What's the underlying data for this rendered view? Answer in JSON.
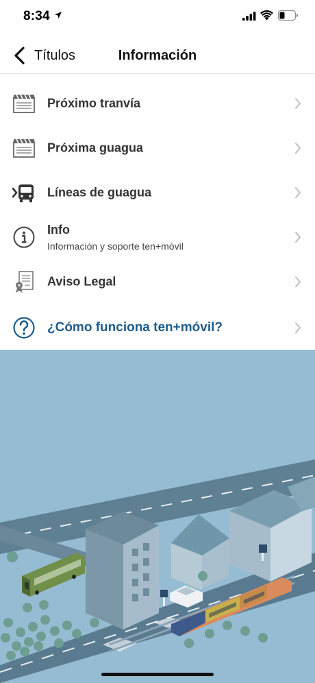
{
  "status": {
    "time": "8:34"
  },
  "nav": {
    "back_label": "Títulos",
    "title": "Información"
  },
  "menu": [
    {
      "label": "Próximo tranvía",
      "icon": "clapperboard-icon"
    },
    {
      "label": "Próxima guagua",
      "icon": "clapperboard-icon"
    },
    {
      "label": "Líneas de guagua",
      "icon": "bus-icon"
    },
    {
      "label": "Info",
      "subtitle": "Información y soporte ten+móvil",
      "icon": "info-icon"
    },
    {
      "label": "Aviso Legal",
      "icon": "certificate-icon"
    },
    {
      "label": "¿Cómo funciona ten+móvil?",
      "icon": "question-icon"
    }
  ],
  "colors": {
    "accent": "#1f5c8c",
    "illustration_bg": "#96bcd3"
  }
}
